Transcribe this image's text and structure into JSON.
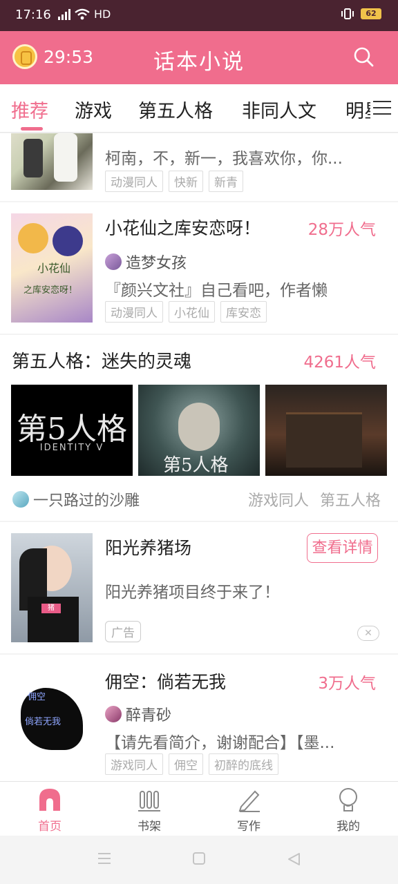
{
  "status_bar": {
    "time": "17:16",
    "network": "4G",
    "hd": "HD",
    "battery": "62"
  },
  "header": {
    "timer": "29:53",
    "title": "话本小说"
  },
  "tabs": [
    {
      "label": "推荐",
      "active": true
    },
    {
      "label": "游戏"
    },
    {
      "label": "第五人格"
    },
    {
      "label": "非同人文"
    },
    {
      "label": "明星"
    }
  ],
  "feed": {
    "item0": {
      "desc": "柯南，不，新一，我喜欢你，你...",
      "tags": [
        "动漫同人",
        "快新",
        "新青"
      ]
    },
    "item1": {
      "title": "小花仙之库安恋呀！",
      "popularity": "28万人气",
      "author": "造梦女孩",
      "desc": "『颜兴文社』自己看吧，作者懒",
      "tags": [
        "动漫同人",
        "小花仙",
        "库安恋"
      ],
      "cover_text": [
        "小花仙",
        "之库安恋呀！"
      ]
    },
    "gallery": {
      "title": "第五人格：迷失的灵魂",
      "popularity": "4261人气",
      "author": "一只路过的沙雕",
      "tags": [
        "游戏同人",
        "第五人格"
      ],
      "image1_text": "第5人格",
      "image1_sub": "IDENTITY V",
      "image2_text": "第5人格"
    },
    "ad": {
      "title": "阳光养猪场",
      "button": "查看详情",
      "desc": "阳光养猪项目终于来了！",
      "label": "广告",
      "close": "✕",
      "cover_badge": "猪"
    },
    "item3": {
      "title": "佣空：倘若无我",
      "popularity": "3万人气",
      "author": "醉青砂",
      "desc": "【请先看简介，谢谢配合】【墨...",
      "tags": [
        "游戏同人",
        "佣空",
        "初醉的底线"
      ],
      "cover_text": [
        "佣空",
        "倘若无我"
      ]
    }
  },
  "bottom_nav": [
    {
      "label": "首页",
      "icon": "home-icon",
      "active": true
    },
    {
      "label": "书架",
      "icon": "bookshelf-icon"
    },
    {
      "label": "写作",
      "icon": "pen-icon"
    },
    {
      "label": "我的",
      "icon": "profile-icon"
    }
  ],
  "colors": {
    "accent": "#f06d8d",
    "status_bar": "#4a2330"
  }
}
